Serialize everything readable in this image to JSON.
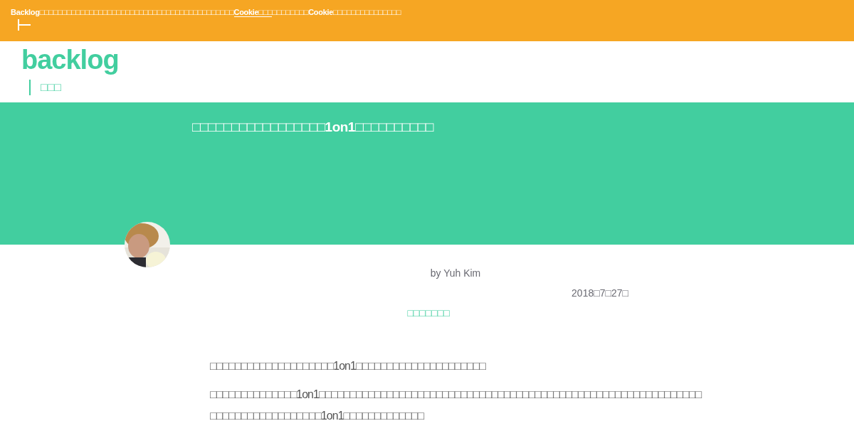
{
  "cookie_banner": {
    "message_parts": [
      {
        "text": "Backlog□□□□□□□□□□□□□□□□□□□□□□□□□□□□□□□□□□□□□□□□□□□",
        "kind": "plain"
      },
      {
        "text": "Cookie□□□",
        "kind": "link"
      },
      {
        "text": "□□□□□□□□Cookie□□□□□□□□□□□□□□□",
        "kind": "plain"
      }
    ]
  },
  "header": {
    "logo": "backlog",
    "nav_item": "□□□"
  },
  "hero": {
    "title": "□□□□□□□□□□□□□□□□□1on1□□□□□□□□□□"
  },
  "article": {
    "author": "by Yuh Kim",
    "date": "2018□7□27□",
    "category": "□□□□□□□",
    "paragraphs": [
      "□□□□□□□□□□□□□□□□□□□□1on1□□□□□□□□□□□□□□□□□□□□□",
      "□□□□□□□□□□□□□□1on1□□□□□□□□□□□□□□□□□□□□□□□□□□□□□□□□□□□□□□□□□□□□□□□□□□□□□□□□□□□□□□□□□□□□□□□□□□□□□□□□1on1□□□□□□□□□□□□□"
    ]
  }
}
